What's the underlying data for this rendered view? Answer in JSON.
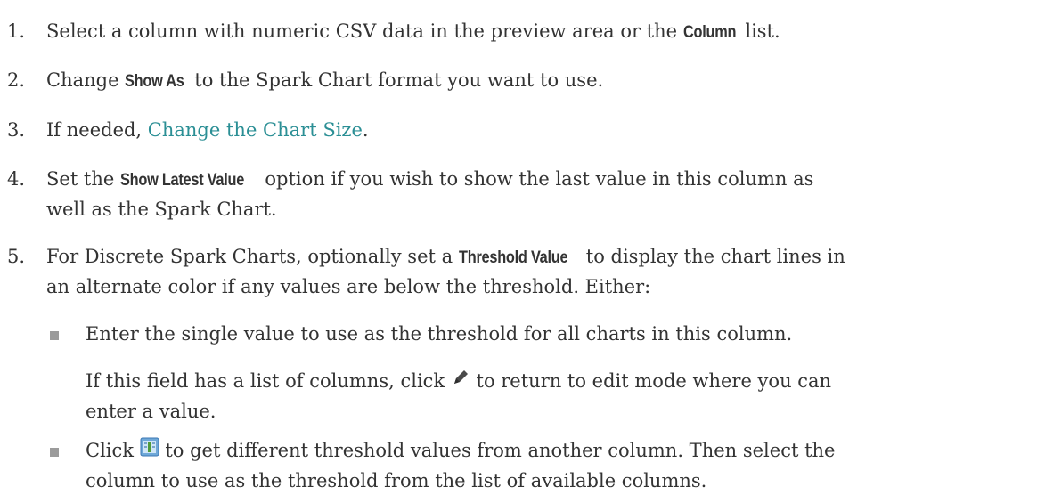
{
  "steps": [
    {
      "num": "1.",
      "pre": "Select a column with numeric CSV data in the preview area or the ",
      "ui": "Column",
      "post": " list."
    },
    {
      "num": "2.",
      "pre": "Change ",
      "ui": "Show As",
      "post": " to the Spark Chart format you want to use."
    },
    {
      "num": "3.",
      "pre": "If needed, ",
      "link": "Change the Chart Size",
      "post": "."
    },
    {
      "num": "4.",
      "pre": "Set the ",
      "ui": "Show Latest Value",
      "post_line1": " option if you wish to show the last value in this column as",
      "line2": "well as the Spark Chart."
    },
    {
      "num": "5.",
      "pre": "For Discrete Spark Charts, optionally set a ",
      "ui": "Threshold Value",
      "post_line1": " to display the chart lines in",
      "line2": "an alternate color if any values are below the threshold. Either:"
    }
  ],
  "bullets": [
    {
      "text": "Enter the single value to use as the threshold for all charts in this column.",
      "para_pre": "If this field has a list of columns, click ",
      "para_icon": "pencil-icon",
      "para_post_line1": " to return to edit mode where you can",
      "para_line2": "enter a value."
    },
    {
      "pre": "Click ",
      "icon": "column-picker-icon",
      "post_line1": " to get different threshold values from another column. Then select the",
      "line2": "column to use as the threshold from the list of available columns."
    }
  ]
}
